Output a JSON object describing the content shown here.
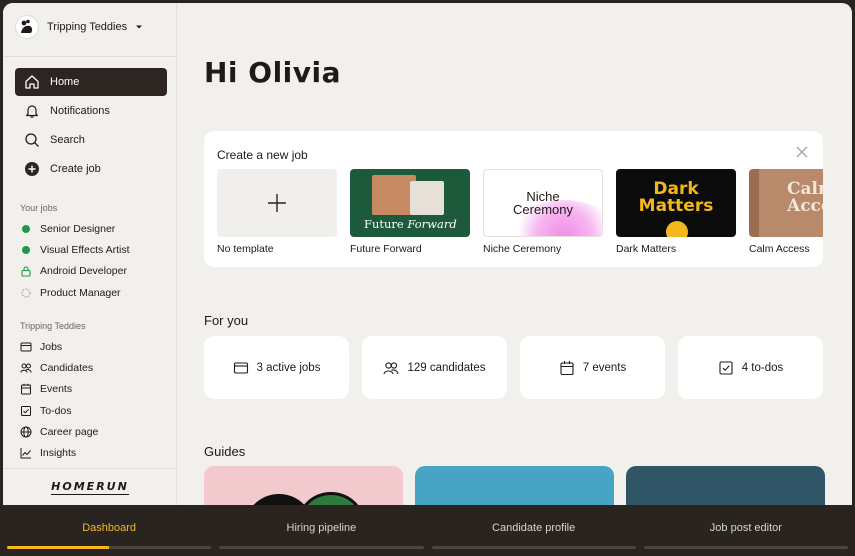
{
  "sidebar": {
    "org_name": "Tripping Teddies",
    "nav": [
      {
        "label": "Home",
        "icon": "home-icon",
        "active": true
      },
      {
        "label": "Notifications",
        "icon": "bell-icon"
      },
      {
        "label": "Search",
        "icon": "search-icon"
      },
      {
        "label": "Create job",
        "icon": "plus-circle-icon"
      }
    ],
    "your_jobs_label": "Your jobs",
    "jobs": [
      {
        "label": "Senior Designer",
        "status": "published"
      },
      {
        "label": "Visual Effects Artist",
        "status": "published"
      },
      {
        "label": "Android Developer",
        "status": "internal"
      },
      {
        "label": "Product Manager",
        "status": "draft"
      }
    ],
    "company_label": "Tripping Teddies",
    "company_links": [
      {
        "label": "Jobs",
        "icon": "jobs-icon"
      },
      {
        "label": "Candidates",
        "icon": "candidates-icon"
      },
      {
        "label": "Events",
        "icon": "calendar-icon"
      },
      {
        "label": "To-dos",
        "icon": "checkbox-icon"
      },
      {
        "label": "Career page",
        "icon": "globe-icon"
      },
      {
        "label": "Insights",
        "icon": "chart-icon"
      }
    ],
    "brand": "HOMERUN"
  },
  "main": {
    "greeting": "Hi Olivia",
    "create": {
      "title": "Create a new job",
      "templates": [
        {
          "label": "No template"
        },
        {
          "label": "Future Forward",
          "thumb_text_a": "Future",
          "thumb_text_b": "Forward"
        },
        {
          "label": "Niche Ceremony",
          "thumb_text_a": "Niche",
          "thumb_text_b": "Ceremony"
        },
        {
          "label": "Dark Matters",
          "thumb_text_a": "Dark",
          "thumb_text_b": "Matters"
        },
        {
          "label": "Calm Access",
          "thumb_text_a": "Calm",
          "thumb_text_b": "Access"
        }
      ]
    },
    "for_you_title": "For you",
    "stats": [
      {
        "label": "3 active jobs",
        "icon": "jobs-icon"
      },
      {
        "label": "129 candidates",
        "icon": "candidates-icon"
      },
      {
        "label": "7 events",
        "icon": "calendar-icon"
      },
      {
        "label": "4 to-dos",
        "icon": "checkbox-icon"
      }
    ],
    "guides_title": "Guides"
  },
  "bottom_tabs": [
    {
      "label": "Dashboard",
      "active": true,
      "progress": 0.5
    },
    {
      "label": "Hiring pipeline",
      "progress": 0
    },
    {
      "label": "Candidate profile",
      "progress": 0
    },
    {
      "label": "Job post editor",
      "progress": 0
    }
  ],
  "colors": {
    "accent": "#f4b71c",
    "dark": "#2c2522",
    "published": "#1d9a47",
    "background": "#f2f0ec"
  }
}
